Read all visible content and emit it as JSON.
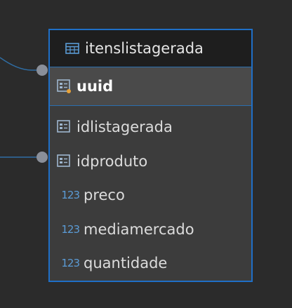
{
  "table": {
    "name": "itenslistagerada",
    "primary_key": "uuid",
    "columns": [
      {
        "name": "idlistagerada",
        "icon": "key-field-icon"
      },
      {
        "name": "idproduto",
        "icon": "key-field-icon"
      },
      {
        "name": "preco",
        "icon": "numeric-icon",
        "type_glyph": "123"
      },
      {
        "name": "mediamercado",
        "icon": "numeric-icon",
        "type_glyph": "123"
      },
      {
        "name": "quantidade",
        "icon": "numeric-icon",
        "type_glyph": "123"
      }
    ]
  },
  "colors": {
    "accent": "#1f6fc7",
    "background": "#2b2b2b",
    "card": "#3c3c3c",
    "connector": "#2f6ea5",
    "connector_dot": "#8a8f99"
  }
}
